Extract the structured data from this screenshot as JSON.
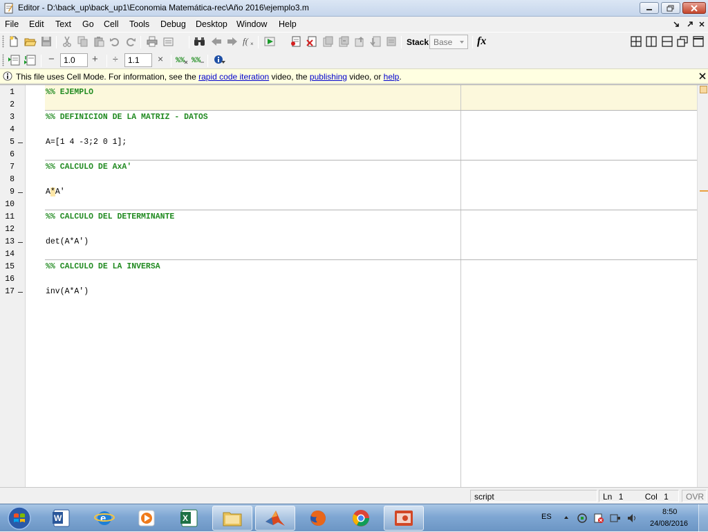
{
  "window": {
    "title": "Editor - D:\\back_up\\back_up1\\Economia Matemática-rec\\Año 2016\\ejemplo3.m"
  },
  "menu": [
    "File",
    "Edit",
    "Text",
    "Go",
    "Cell",
    "Tools",
    "Debug",
    "Desktop",
    "Window",
    "Help"
  ],
  "toolbar": {
    "stack_label": "Stack:",
    "stack_value": "Base",
    "fx_label": "fx"
  },
  "cell_toolbar": {
    "minus": "−",
    "value1": "1.0",
    "plus": "+",
    "divide": "÷",
    "value2": "1.1",
    "times": "×"
  },
  "infobar": {
    "prefix": "This file uses Cell Mode. For information, see the ",
    "link1": "rapid code iteration",
    "mid1": " video, the ",
    "link2": "publishing",
    "mid2": " video, or ",
    "link3": "help",
    "suffix": "."
  },
  "editor": {
    "line_numbers": [
      "1",
      "2",
      "3",
      "4",
      "5",
      "6",
      "7",
      "8",
      "9",
      "10",
      "11",
      "12",
      "13",
      "14",
      "15",
      "16",
      "17"
    ],
    "lines": {
      "l1": "%% EJEMPLO",
      "l3": "%% DEFINICION DE LA MATRIZ - DATOS",
      "l5": "A=[1 4 -3;2 0 1];",
      "l7": "%% CALCULO DE AxA'",
      "l9a": "A",
      "l9b": "*",
      "l9c": "A'",
      "l11": "%% CALCULO DEL DETERMINANTE",
      "l13": "det(A*A')",
      "l15": "%% CALCULO DE LA INVERSA",
      "l17": "inv(A*A')"
    }
  },
  "status": {
    "mode": "script",
    "ln_label": "Ln",
    "ln_value": "1",
    "col_label": "Col",
    "col_value": "1",
    "ovr": "OVR"
  },
  "taskbar": {
    "lang": "ES",
    "time": "8:50",
    "date": "24/08/2016"
  }
}
